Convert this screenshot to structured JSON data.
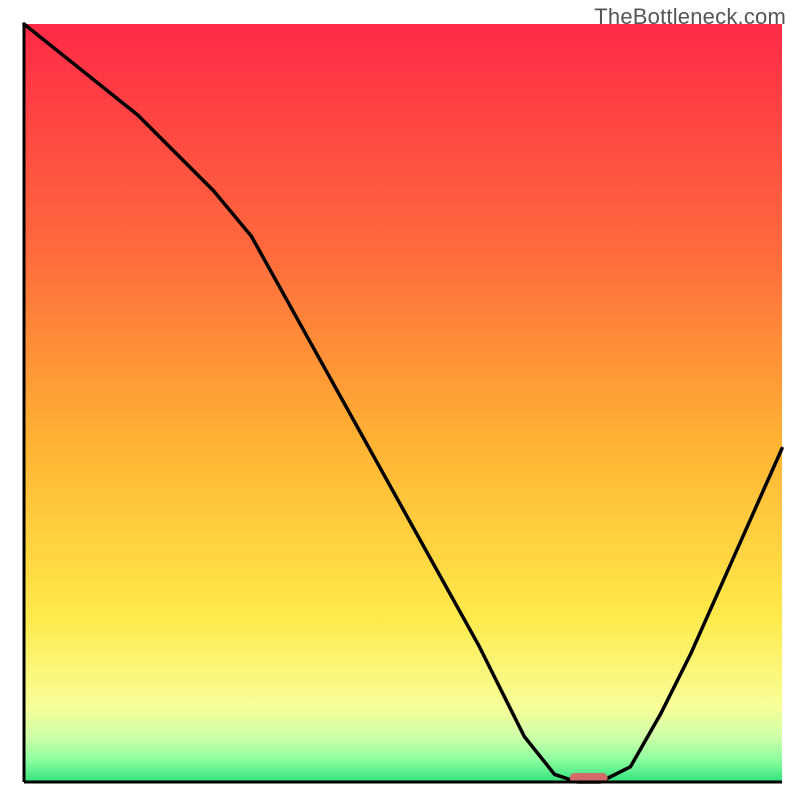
{
  "watermark": "TheBottleneck.com",
  "chart_data": {
    "type": "line",
    "title": "",
    "xlabel": "",
    "ylabel": "",
    "xlim": [
      0,
      100
    ],
    "ylim": [
      0,
      100
    ],
    "x": [
      0,
      5,
      10,
      15,
      20,
      25,
      30,
      35,
      40,
      45,
      50,
      55,
      60,
      62,
      66,
      70,
      73,
      76,
      80,
      84,
      88,
      92,
      96,
      100
    ],
    "values": [
      100,
      96,
      92,
      88,
      83,
      78,
      72,
      63,
      54,
      45,
      36,
      27,
      18,
      14,
      6,
      1,
      0,
      0,
      2,
      9,
      17,
      26,
      35,
      44
    ],
    "marker": {
      "x_start": 72,
      "x_end": 77,
      "y": 0
    },
    "background_gradient_stops": [
      {
        "offset": 0.0,
        "color": "#ff2a47"
      },
      {
        "offset": 0.3,
        "color": "#ff6a3d"
      },
      {
        "offset": 0.55,
        "color": "#ffb233"
      },
      {
        "offset": 0.78,
        "color": "#ffe94a"
      },
      {
        "offset": 0.9,
        "color": "#f8ff98"
      },
      {
        "offset": 0.94,
        "color": "#cfffa8"
      },
      {
        "offset": 0.97,
        "color": "#8effa0"
      },
      {
        "offset": 1.0,
        "color": "#32e27c"
      }
    ],
    "marker_color": "#d46a6a",
    "curve_color": "#000000",
    "axis_color": "#000000"
  },
  "layout": {
    "inner_x": 24,
    "inner_y": 24,
    "inner_w": 758,
    "inner_h": 758
  }
}
